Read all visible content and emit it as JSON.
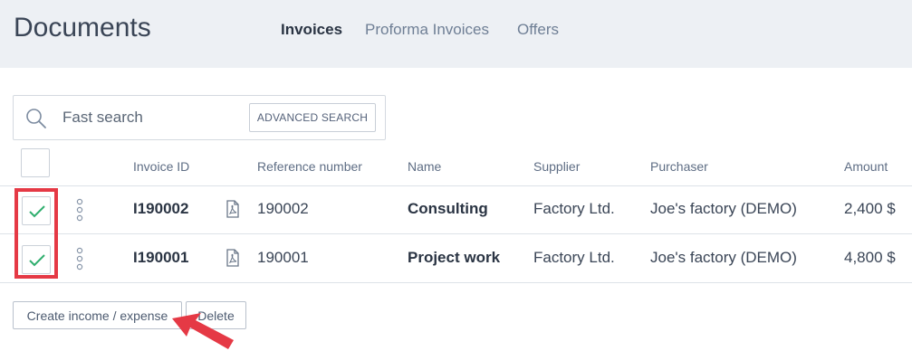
{
  "header": {
    "title": "Documents",
    "tabs": [
      {
        "label": "Invoices",
        "active": true
      },
      {
        "label": "Proforma Invoices",
        "active": false
      },
      {
        "label": "Offers",
        "active": false
      }
    ]
  },
  "search": {
    "placeholder": "Fast search",
    "advanced_label": "ADVANCED SEARCH",
    "icon": "search-icon"
  },
  "table": {
    "columns": {
      "invoice_id": "Invoice ID",
      "reference": "Reference number",
      "name": "Name",
      "supplier": "Supplier",
      "purchaser": "Purchaser",
      "amount": "Amount"
    },
    "rows": [
      {
        "checked": true,
        "invoice_id": "I190002",
        "reference": "190002",
        "name": "Consulting",
        "supplier": "Factory Ltd.",
        "purchaser": "Joe's factory (DEMO)",
        "amount": "2,400 $"
      },
      {
        "checked": true,
        "invoice_id": "I190001",
        "reference": "190001",
        "name": "Project work",
        "supplier": "Factory Ltd.",
        "purchaser": "Joe's factory (DEMO)",
        "amount": "4,800 $"
      }
    ]
  },
  "actions": {
    "create_label": "Create income / expense",
    "delete_label": "Delete"
  },
  "colors": {
    "check": "#2fae6e",
    "highlight": "#e53945",
    "header_bg": "#edf0f4"
  }
}
